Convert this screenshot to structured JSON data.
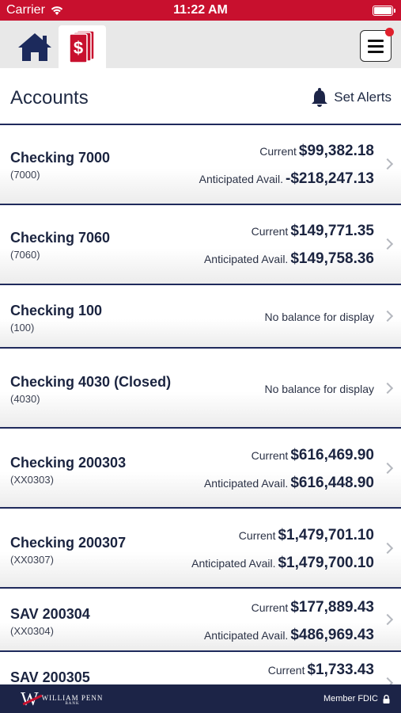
{
  "status_bar": {
    "carrier": "Carrier",
    "time": "11:22 AM"
  },
  "nav": {
    "tabs": [
      {
        "icon": "home-icon"
      },
      {
        "icon": "accounts-dollar-icon"
      }
    ],
    "menu_icon": "hamburger-menu-icon"
  },
  "header": {
    "title": "Accounts",
    "alerts_label": "Set Alerts"
  },
  "accounts": [
    {
      "name": "Checking 7000",
      "number": "(7000)",
      "current_label": "Current",
      "current": "$99,382.18",
      "anticipated_label": "Anticipated Avail.",
      "anticipated": "-$218,247.13"
    },
    {
      "name": "Checking 7060",
      "number": "(7060)",
      "current_label": "Current",
      "current": "$149,771.35",
      "anticipated_label": "Anticipated Avail.",
      "anticipated": "$149,758.36"
    },
    {
      "name": "Checking 100",
      "number": "(100)",
      "no_balance": "No balance for display"
    },
    {
      "name": "Checking 4030 (Closed)",
      "number": "(4030)",
      "no_balance": "No balance for display"
    },
    {
      "name": "Checking 200303",
      "number": "(XX0303)",
      "current_label": "Current",
      "current": "$616,469.90",
      "anticipated_label": "Anticipated Avail.",
      "anticipated": "$616,448.90"
    },
    {
      "name": "Checking 200307",
      "number": "(XX0307)",
      "current_label": "Current",
      "current": "$1,479,701.10",
      "anticipated_label": "Anticipated Avail.",
      "anticipated": "$1,479,700.10"
    },
    {
      "name": "SAV 200304",
      "number": "(XX0304)",
      "current_label": "Current",
      "current": "$177,889.43",
      "anticipated_label": "Anticipated Avail.",
      "anticipated": "$486,969.43"
    },
    {
      "name": "SAV 200305",
      "current_label": "Current",
      "current": "$1,733.43"
    }
  ],
  "footer": {
    "bank_name": "WILLIAM PENN",
    "bank_sub": "BANK",
    "member": "Member FDIC"
  },
  "colors": {
    "brand_red": "#c8102e",
    "navy": "#1c2447"
  }
}
